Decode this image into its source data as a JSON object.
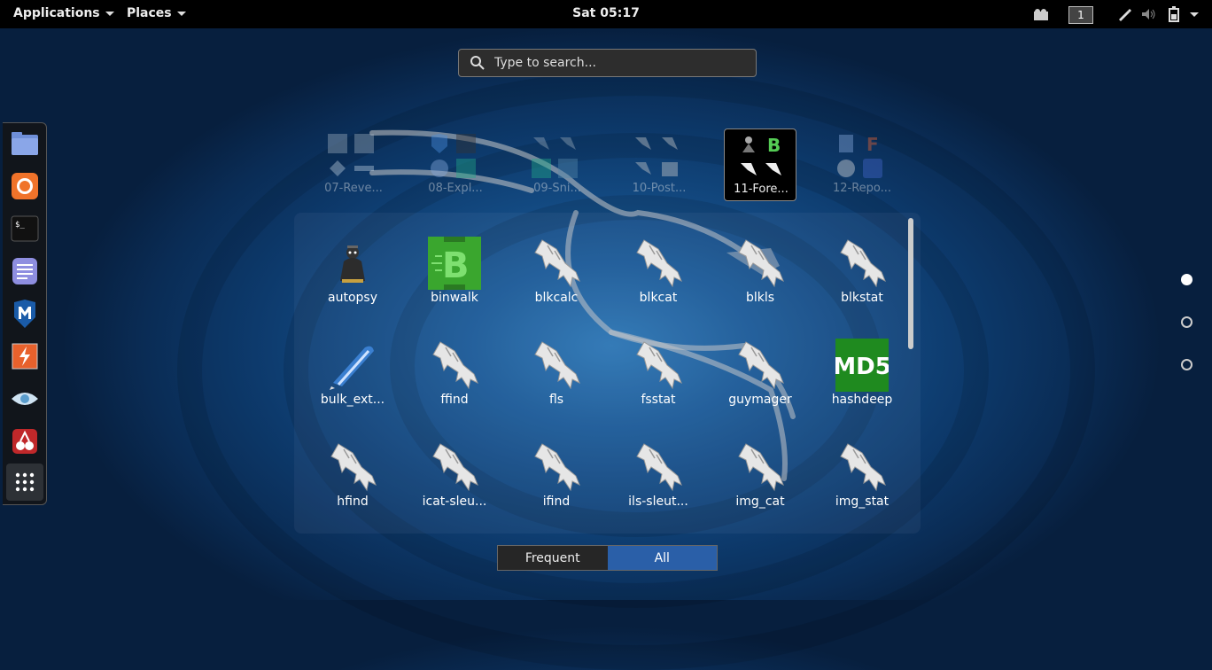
{
  "topbar": {
    "applications": "Applications",
    "places": "Places",
    "clock": "Sat 05:17",
    "workspace": "1",
    "tray_icons": [
      "camera-icon",
      "pen-icon",
      "volume-icon",
      "battery-icon",
      "chevron-down-icon"
    ]
  },
  "dash": {
    "items": [
      "files-icon",
      "firefox-icon",
      "terminal-icon",
      "text-editor-icon",
      "metasploit-icon",
      "burpsuite-icon",
      "eye-icon",
      "cherrytree-icon"
    ],
    "show_apps": "app-grid-icon"
  },
  "search": {
    "placeholder": "Type to search..."
  },
  "folders": [
    {
      "label": "07-Reve..."
    },
    {
      "label": "08-Expl..."
    },
    {
      "label": "09-Sni..."
    },
    {
      "label": "10-Post..."
    },
    {
      "label": "11-Fore..."
    },
    {
      "label": "12-Repo..."
    }
  ],
  "apps": [
    {
      "label": "autopsy",
      "icon": "autopsy-icon"
    },
    {
      "label": "binwalk",
      "icon": "binwalk-icon"
    },
    {
      "label": "blkcalc",
      "icon": "kali-dragon-icon"
    },
    {
      "label": "blkcat",
      "icon": "kali-dragon-icon"
    },
    {
      "label": "blkls",
      "icon": "kali-dragon-icon"
    },
    {
      "label": "blkstat",
      "icon": "kali-dragon-icon"
    },
    {
      "label": "bulk_ext...",
      "icon": "bulk-extractor-icon"
    },
    {
      "label": "ffind",
      "icon": "kali-dragon-icon"
    },
    {
      "label": "fls",
      "icon": "kali-dragon-icon"
    },
    {
      "label": "fsstat",
      "icon": "kali-dragon-icon"
    },
    {
      "label": "guymager",
      "icon": "kali-dragon-icon"
    },
    {
      "label": "hashdeep",
      "icon": "md5-icon",
      "icon_text": "MD5"
    },
    {
      "label": "hfind",
      "icon": "kali-dragon-icon"
    },
    {
      "label": "icat-sleu...",
      "icon": "kali-dragon-icon"
    },
    {
      "label": "ifind",
      "icon": "kali-dragon-icon"
    },
    {
      "label": "ils-sleut...",
      "icon": "kali-dragon-icon"
    },
    {
      "label": "img_cat",
      "icon": "kali-dragon-icon"
    },
    {
      "label": "img_stat",
      "icon": "kali-dragon-icon"
    }
  ],
  "pages": {
    "count": 3,
    "current": 1
  },
  "view_toggle": {
    "frequent": "Frequent",
    "all": "All",
    "selected": "All"
  },
  "colors": {
    "selected_toggle": "#2a5fa8",
    "md5_bg": "#1f8a1f",
    "binwalk_bg": "#3aa62e"
  }
}
